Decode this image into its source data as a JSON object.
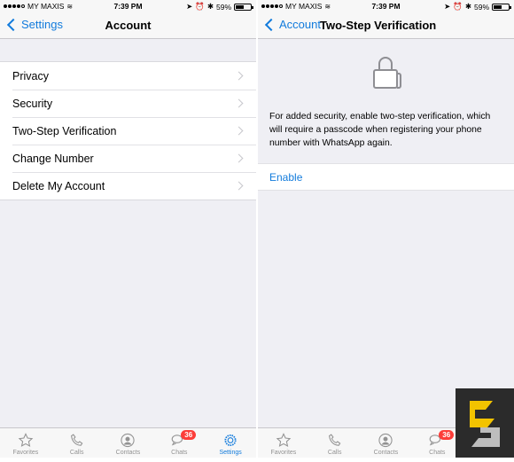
{
  "status": {
    "carrier": "MY MAXIS",
    "time": "7:39 PM",
    "battery": "59%"
  },
  "left_screen": {
    "back_label": "Settings",
    "title": "Account",
    "items": [
      {
        "label": "Privacy"
      },
      {
        "label": "Security"
      },
      {
        "label": "Two-Step Verification"
      },
      {
        "label": "Change Number"
      },
      {
        "label": "Delete My Account"
      }
    ]
  },
  "right_screen": {
    "back_label": "Account",
    "title": "Two-Step Verification",
    "description": "For added security, enable two-step verification, which will require a passcode when registering your phone number with WhatsApp again.",
    "enable_label": "Enable"
  },
  "tabbar": {
    "tabs": [
      {
        "label": "Favorites",
        "icon": "star-icon"
      },
      {
        "label": "Calls",
        "icon": "phone-icon"
      },
      {
        "label": "Contacts",
        "icon": "person-icon"
      },
      {
        "label": "Chats",
        "icon": "chat-bubbles-icon",
        "badge": "36"
      },
      {
        "label": "Settings",
        "icon": "gear-icon",
        "active": true
      }
    ]
  },
  "colors": {
    "accent": "#127bdc",
    "badge": "#fc3d39",
    "background": "#efeff4"
  }
}
